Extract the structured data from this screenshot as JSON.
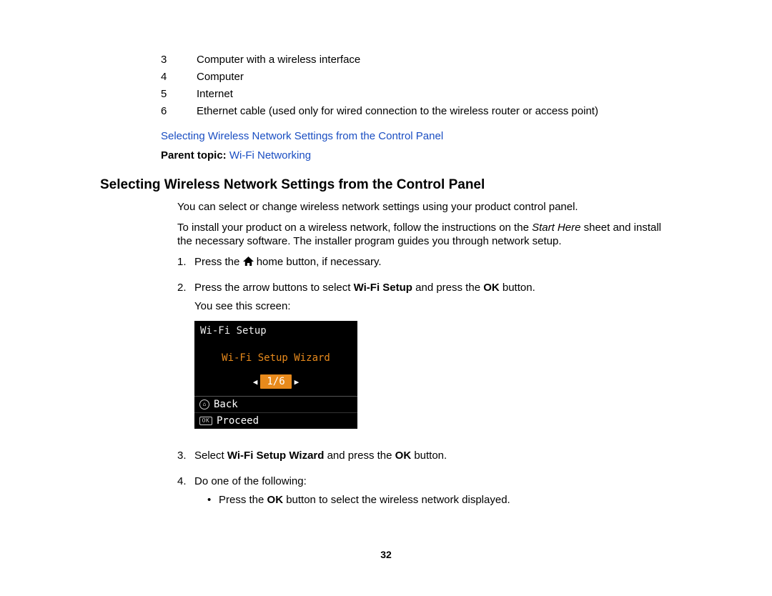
{
  "numbered_items": [
    {
      "num": "3",
      "text": "Computer with a wireless interface"
    },
    {
      "num": "4",
      "text": "Computer"
    },
    {
      "num": "5",
      "text": "Internet"
    },
    {
      "num": "6",
      "text": "Ethernet cable (used only for wired connection to the wireless router or access point)"
    }
  ],
  "link_line": "Selecting Wireless Network Settings from the Control Panel",
  "parent_topic_label": "Parent topic: ",
  "parent_topic_value": "Wi-Fi Networking",
  "section_heading": "Selecting Wireless Network Settings from the Control Panel",
  "intro_1": "You can select or change wireless network settings using your product control panel.",
  "intro_2_a": "To install your product on a wireless network, follow the instructions on the ",
  "intro_2_b": "Start Here",
  "intro_2_c": " sheet and install the necessary software. The installer program guides you through network setup.",
  "step1": {
    "num": "1.",
    "pre": "Press the ",
    "post": " home button, if necessary."
  },
  "step2": {
    "num": "2.",
    "pre": "Press the arrow buttons to select ",
    "b1": "Wi-Fi Setup",
    "mid": " and press the ",
    "b2": "OK",
    "post": " button.",
    "sub": "You see this screen:"
  },
  "screen": {
    "header": "Wi-Fi Setup",
    "highlight": "Wi-Fi Setup Wizard",
    "counter": "1/6",
    "back_label": "Back",
    "back_icon_text": "⌂",
    "proceed_label": "Proceed",
    "proceed_icon_text": "OK"
  },
  "step3": {
    "num": "3.",
    "pre": "Select ",
    "b1": "Wi-Fi Setup Wizard",
    "mid": " and press the ",
    "b2": "OK",
    "post": " button."
  },
  "step4": {
    "num": "4.",
    "text": "Do one of the following:",
    "bullet_pre": "Press the ",
    "bullet_b": "OK",
    "bullet_post": " button to select the wireless network displayed."
  },
  "page_number": "32"
}
